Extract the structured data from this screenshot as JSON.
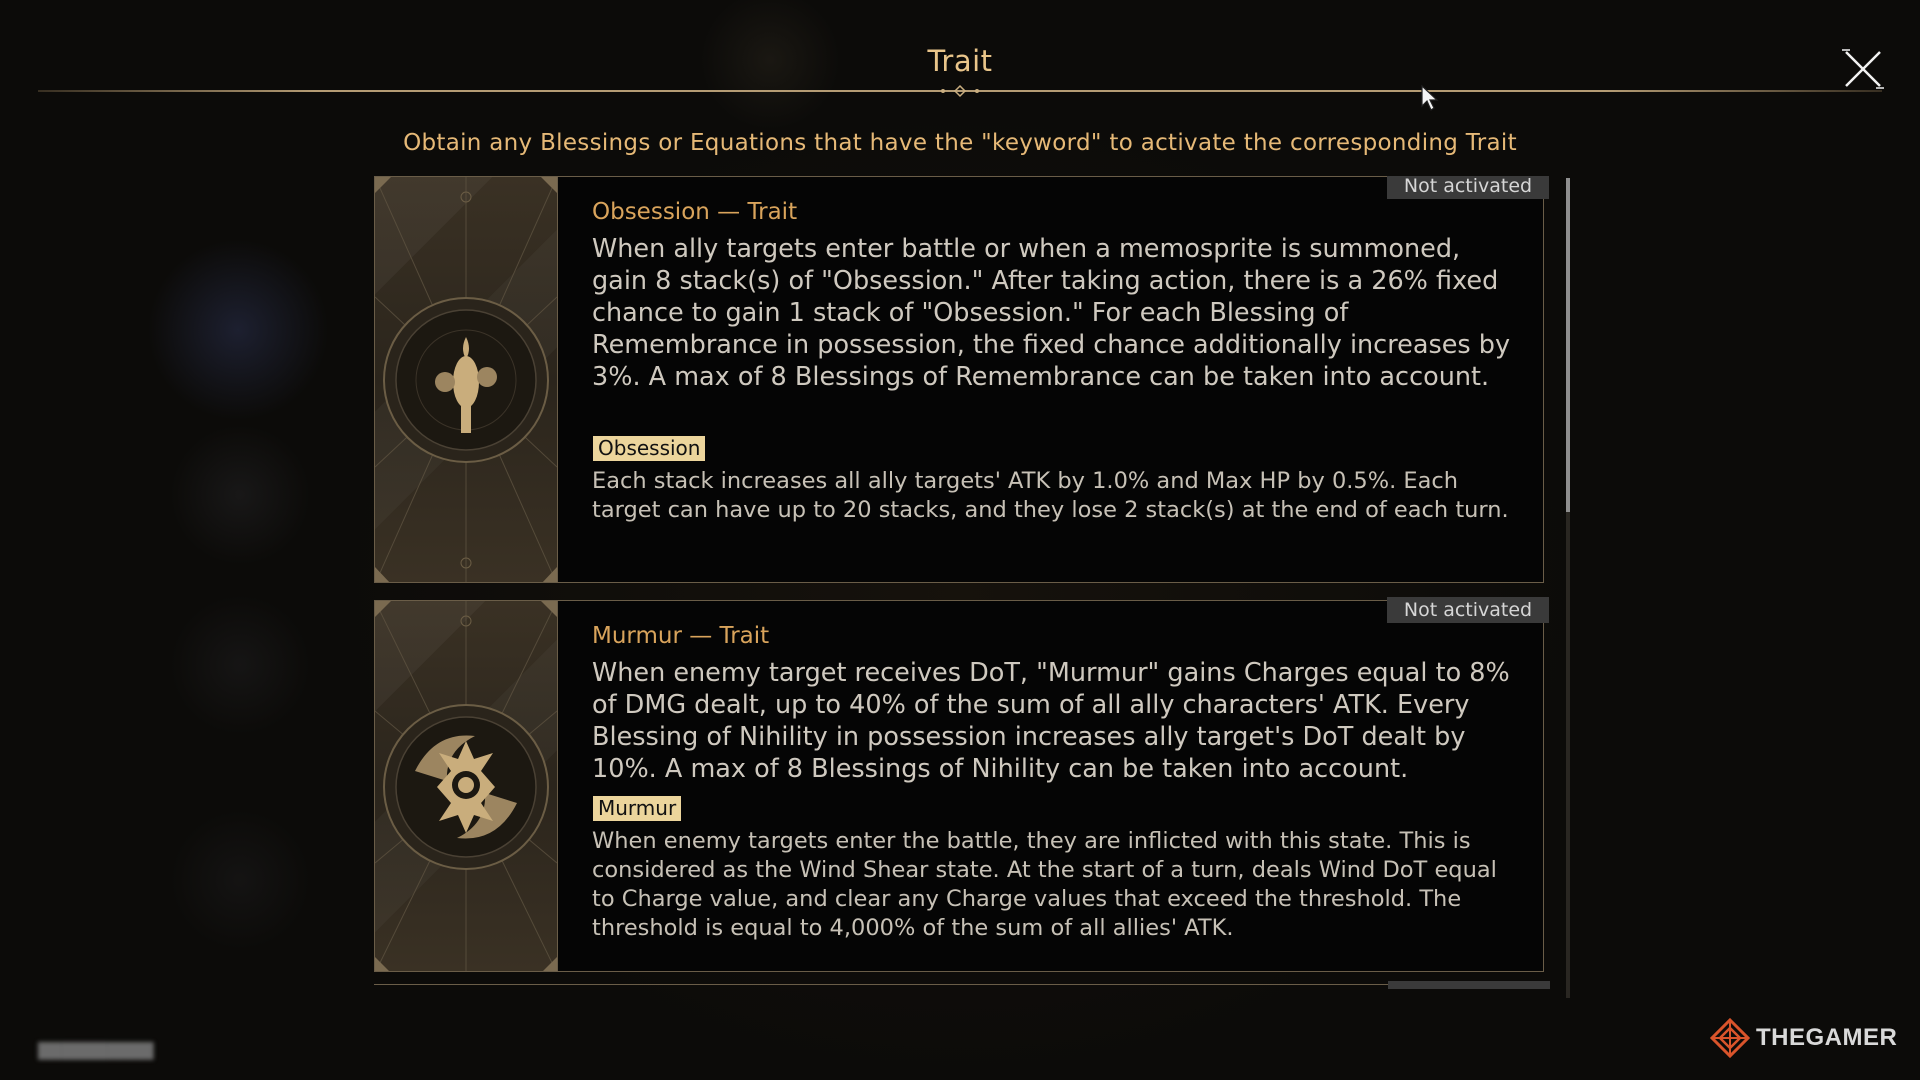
{
  "header": {
    "title": "Trait",
    "close_icon": "close-icon"
  },
  "subtitle": "Obtain any Blessings or Equations that have the \"keyword\" to activate the corresponding Trait",
  "traits": [
    {
      "status": "Not activated",
      "title": "Obsession — Trait",
      "icon": "remembrance-path-icon",
      "description": "When ally targets enter battle or when a memosprite is summoned, gain 8 stack(s) of \"Obsession.\" After taking action, there is a 26% fixed chance to gain 1 stack of \"Obsession.\" For each Blessing of Remembrance in possession, the fixed chance additionally increases by 3%. A max of 8 Blessings of Remembrance can be taken into account.",
      "keyword": "Obsession",
      "keyword_description": "Each stack increases all ally targets' ATK by 1.0% and Max HP by 0.5%. Each target can have up to 20 stacks, and they lose 2 stack(s) at the end of each turn."
    },
    {
      "status": "Not activated",
      "title": "Murmur — Trait",
      "icon": "nihility-path-icon",
      "description": "When enemy target receives DoT, \"Murmur\" gains Charges equal to 8% of DMG dealt, up to 40% of the sum of all ally characters' ATK. Every Blessing of Nihility in possession increases ally target's DoT dealt by 10%. A max of 8 Blessings of Nihility can be taken into account.",
      "keyword": "Murmur",
      "keyword_description": "When enemy targets enter the battle, they are inflicted with this state. This is considered as the Wind Shear state. At the start of a turn, deals Wind DoT equal to Charge value, and clear any Charge values that exceed the threshold. The threshold is equal to 4,000% of the sum of all allies' ATK."
    }
  ],
  "watermark": "THEGAMER",
  "colors": {
    "accent": "#e9c58a",
    "trait_title": "#d9a45c",
    "keyword_bg": "#ecd59c",
    "badge_bg": "#3a3a3a"
  }
}
